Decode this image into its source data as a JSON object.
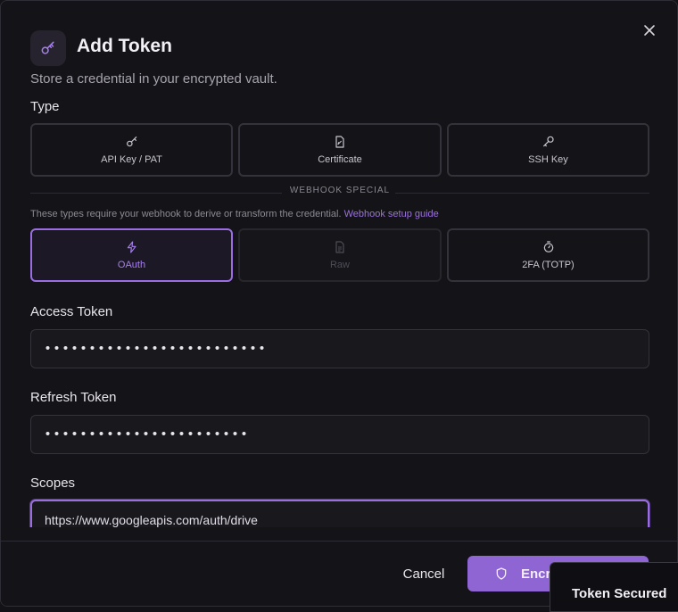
{
  "dialog": {
    "title": "Add Token",
    "subtitle": "Store a credential in your encrypted vault.",
    "icons": {
      "header": "key-icon",
      "close": "close-icon"
    }
  },
  "type_section": {
    "label": "Type",
    "standard_types": [
      {
        "label": "API Key / PAT",
        "icon": "key-icon",
        "state": "default"
      },
      {
        "label": "Certificate",
        "icon": "file-signature-icon",
        "state": "default"
      },
      {
        "label": "SSH Key",
        "icon": "wrench-key-icon",
        "state": "default"
      }
    ],
    "divider": "WEBHOOK SPECIAL",
    "help_text": "These types require your webhook to derive or transform the credential.",
    "help_link": "Webhook setup guide",
    "webhook_types": [
      {
        "label": "OAuth",
        "icon": "lightning-icon",
        "state": "selected"
      },
      {
        "label": "Raw",
        "icon": "file-text-icon",
        "state": "disabled"
      },
      {
        "label": "2FA (TOTP)",
        "icon": "timer-icon",
        "state": "default"
      }
    ]
  },
  "fields": {
    "access_token": {
      "label": "Access Token",
      "value": "•••••••••••••••••••••••••"
    },
    "refresh_token": {
      "label": "Refresh Token",
      "value": "•••••••••••••••••••••••"
    },
    "scopes": {
      "label": "Scopes",
      "value": "https://www.googleapis.com/auth/drive"
    }
  },
  "footer": {
    "cancel_label": "Cancel",
    "encrypt_label": "Encrypt & Save",
    "encrypt_icon": "shield-icon"
  },
  "toast": {
    "text": "Token Secured"
  },
  "colors": {
    "accent": "#9a6ee0",
    "background": "#141317",
    "border": "#34323a"
  }
}
